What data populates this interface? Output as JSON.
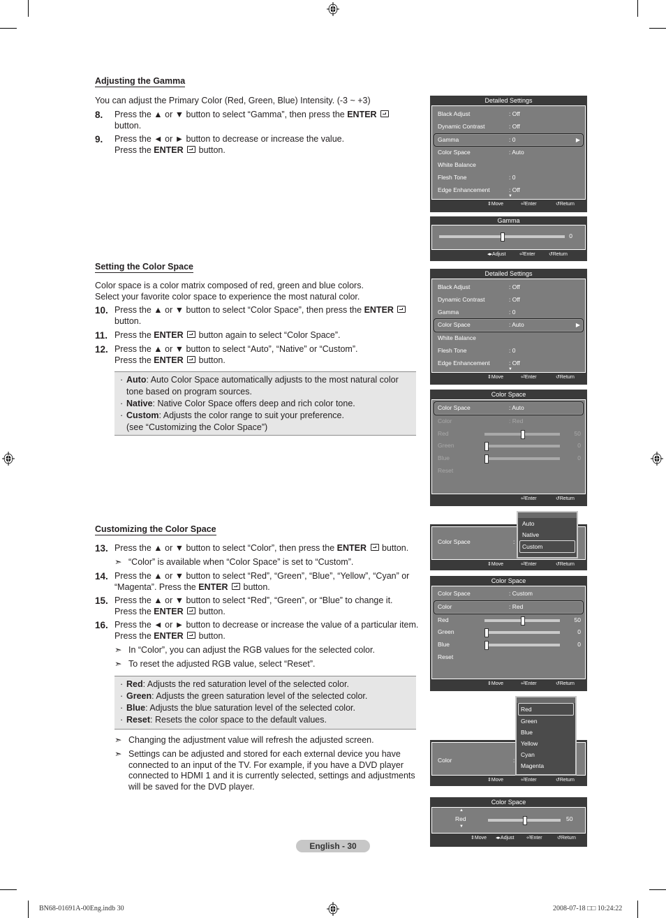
{
  "page": {
    "footer_badge": "English - 30",
    "footer_file": "BN68-01691A-00Eng.indb   30",
    "footer_timestamp": "2008-07-18   □□ 10:24:22"
  },
  "sections": {
    "gamma": {
      "heading": "Adjusting the Gamma",
      "intro": "You can adjust the Primary Color (Red, Green, Blue) Intensity. (-3 ~ +3)",
      "steps": [
        {
          "num": "8.",
          "pre": "Press the ▲ or ▼ button to select “Gamma”, then press the ",
          "bold": "ENTER",
          "post": " button."
        },
        {
          "num": "9.",
          "pre": "Press the ◄ or ► button to decrease or increase the value.",
          "line2_pre": "Press the ",
          "bold": "ENTER",
          "post": " button."
        }
      ]
    },
    "colorspace": {
      "heading": "Setting the Color Space",
      "intro1": "Color space is a color matrix composed of red, green and blue colors.",
      "intro2": "Select your favorite color space to experience the most natural color.",
      "steps": [
        {
          "num": "10.",
          "pre": "Press the ▲ or ▼ button to select “Color Space”, then press the ",
          "bold": "ENTER",
          "post": " button."
        },
        {
          "num": "11.",
          "pre": "Press the ",
          "bold": "ENTER",
          "post": " button again to select “Color Space”."
        },
        {
          "num": "12.",
          "pre": "Press the ▲ or ▼ button to select “Auto”, “Native” or “Custom”.",
          "line2_pre": "Press the ",
          "bold": "ENTER",
          "post": " button."
        }
      ],
      "bullets": [
        {
          "term": "Auto",
          "text": ": Auto Color Space automatically adjusts to the most natural color tone based on program sources."
        },
        {
          "term": "Native",
          "text": ": Native Color Space offers deep and rich color tone."
        },
        {
          "term": "Custom",
          "text": ": Adjusts the color range to suit your preference.",
          "extra": "(see “Customizing the Color Space”)"
        }
      ]
    },
    "customizing": {
      "heading": "Customizing the Color Space",
      "steps": [
        {
          "num": "13.",
          "pre": "Press the ▲ or ▼ button to select “Color”, then press the ",
          "bold": "ENTER",
          "post": " button."
        },
        {
          "num": "14.",
          "pre": "Press the ▲ or ▼ button to select “Red”, “Green”, “Blue”, “Yellow”, “Cyan” or “Magenta”. Press the ",
          "bold": "ENTER",
          "post": " button."
        },
        {
          "num": "15.",
          "pre": "Press the ▲ or ▼ button to select “Red”, “Green”, or “Blue” to change it.",
          "line2_pre": "Press the ",
          "bold": "ENTER",
          "post": " button."
        },
        {
          "num": "16.",
          "pre": "Press the ◄ or ► button to decrease or increase the value of a particular item. Press the ",
          "bold": "ENTER",
          "post": " button."
        }
      ],
      "note_13": "“Color” is available when “Color Space” is set to “Custom”.",
      "notes_16": [
        "In “Color”, you can adjust the RGB values for the selected color.",
        "To reset the adjusted RGB value, select “Reset”."
      ],
      "bullets": [
        {
          "term": "Red",
          "text": ": Adjusts the red saturation level of the selected color."
        },
        {
          "term": "Green",
          "text": ": Adjusts the green saturation level of the selected color."
        },
        {
          "term": "Blue",
          "text": ": Adjusts the blue saturation level of the selected color."
        },
        {
          "term": "Reset",
          "text": ": Resets the color space to the default values."
        }
      ],
      "final_notes": [
        "Changing the adjustment value will refresh the adjusted screen.",
        "Settings can be adjusted and stored for each external device you have connected to an input of the TV. For example, if you have a DVD player connected to HDMI 1 and it is currently selected, settings and adjustments will be saved for the DVD player."
      ]
    }
  },
  "osd": {
    "footer": {
      "move": "Move",
      "enter": "Enter",
      "return": "Return",
      "adjust": "Adjust"
    },
    "detailed1": {
      "title": "Detailed Settings",
      "rows": [
        {
          "label": "Black Adjust",
          "value": ": Off"
        },
        {
          "label": "Dynamic Contrast",
          "value": ": Off"
        },
        {
          "label": "Gamma",
          "value": ": 0",
          "selected": true
        },
        {
          "label": "Color Space",
          "value": ": Auto"
        },
        {
          "label": "White Balance",
          "value": ""
        },
        {
          "label": "Flesh Tone",
          "value": ": 0"
        },
        {
          "label": "Edge Enhancement",
          "value": ": Off"
        }
      ]
    },
    "gamma_slider": {
      "title": "Gamma",
      "value": "0",
      "position": 0.5
    },
    "detailed2": {
      "title": "Detailed Settings",
      "rows": [
        {
          "label": "Black Adjust",
          "value": ": Off"
        },
        {
          "label": "Dynamic Contrast",
          "value": ": Off"
        },
        {
          "label": "Gamma",
          "value": ": 0"
        },
        {
          "label": "Color Space",
          "value": ": Auto",
          "selected": true
        },
        {
          "label": "White Balance",
          "value": ""
        },
        {
          "label": "Flesh Tone",
          "value": ": 0"
        },
        {
          "label": "Edge Enhancement",
          "value": ": Off"
        }
      ]
    },
    "colorspace_auto": {
      "title": "Color Space",
      "rows": [
        {
          "label": "Color Space",
          "value": ": Auto"
        },
        {
          "label": "Color",
          "value": ": Red"
        },
        {
          "label": "Red",
          "value": "50",
          "level": 0.5
        },
        {
          "label": "Green",
          "value": "0",
          "level": 0
        },
        {
          "label": "Blue",
          "value": "0",
          "level": 0
        },
        {
          "label": "Reset",
          "value": ""
        }
      ]
    },
    "colorspace_popup": {
      "label": "Color Space",
      "options": [
        "Auto",
        "Native",
        "Custom"
      ],
      "selected": "Custom"
    },
    "colorspace_custom": {
      "title": "Color Space",
      "rows": [
        {
          "label": "Color Space",
          "value": ": Custom"
        },
        {
          "label": "Color",
          "value": ": Red"
        },
        {
          "label": "Red",
          "value": "50",
          "level": 0.5
        },
        {
          "label": "Green",
          "value": "0",
          "level": 0
        },
        {
          "label": "Blue",
          "value": "0",
          "level": 0
        },
        {
          "label": "Reset",
          "value": ""
        }
      ]
    },
    "color_popup": {
      "label": "Color",
      "options": [
        "Red",
        "Green",
        "Blue",
        "Yellow",
        "Cyan",
        "Magenta"
      ],
      "selected": "Red"
    },
    "red_adjust": {
      "title": "Color Space",
      "label": "Red",
      "value": "50",
      "position": 0.5
    }
  }
}
